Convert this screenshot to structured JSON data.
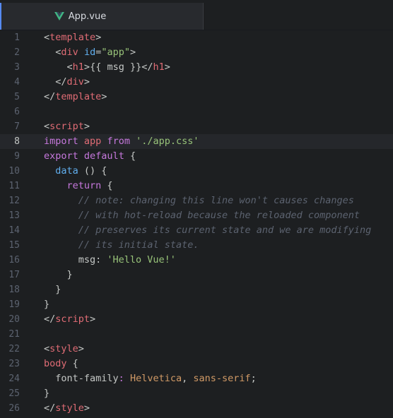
{
  "tab": {
    "filename": "App.vue",
    "icon": "vue-logo-icon",
    "accent_color": "#568af2",
    "vue_green": "#41b883",
    "vue_dark": "#35495e"
  },
  "active_line": 8,
  "lines": [
    {
      "n": "1",
      "tokens": [
        [
          "tag",
          "<"
        ],
        [
          "tagname",
          "template"
        ],
        [
          "tag",
          ">"
        ]
      ]
    },
    {
      "n": "2",
      "tokens": [
        [
          "plain",
          "  "
        ],
        [
          "tag",
          "<"
        ],
        [
          "tagname",
          "div"
        ],
        [
          "plain",
          " "
        ],
        [
          "attr",
          "id"
        ],
        [
          "tag",
          "="
        ],
        [
          "str",
          "\"app\""
        ],
        [
          "tag",
          ">"
        ]
      ]
    },
    {
      "n": "3",
      "tokens": [
        [
          "plain",
          "    "
        ],
        [
          "tag",
          "<"
        ],
        [
          "tagname",
          "h1"
        ],
        [
          "tag",
          ">"
        ],
        [
          "plain",
          "{{ msg }}"
        ],
        [
          "tag",
          "</"
        ],
        [
          "tagname",
          "h1"
        ],
        [
          "tag",
          ">"
        ]
      ]
    },
    {
      "n": "4",
      "tokens": [
        [
          "plain",
          "  "
        ],
        [
          "tag",
          "</"
        ],
        [
          "tagname",
          "div"
        ],
        [
          "tag",
          ">"
        ]
      ]
    },
    {
      "n": "5",
      "tokens": [
        [
          "tag",
          "</"
        ],
        [
          "tagname",
          "template"
        ],
        [
          "tag",
          ">"
        ]
      ]
    },
    {
      "n": "6",
      "tokens": []
    },
    {
      "n": "7",
      "tokens": [
        [
          "tag",
          "<"
        ],
        [
          "tagname",
          "script"
        ],
        [
          "tag",
          ">"
        ]
      ]
    },
    {
      "n": "8",
      "tokens": [
        [
          "kw",
          "import"
        ],
        [
          "plain",
          " "
        ],
        [
          "tagname",
          "app"
        ],
        [
          "plain",
          " "
        ],
        [
          "kw",
          "from"
        ],
        [
          "plain",
          " "
        ],
        [
          "str",
          "'./app.css'"
        ]
      ]
    },
    {
      "n": "9",
      "tokens": [
        [
          "kw",
          "export"
        ],
        [
          "plain",
          " "
        ],
        [
          "kw",
          "default"
        ],
        [
          "plain",
          " {"
        ]
      ]
    },
    {
      "n": "10",
      "tokens": [
        [
          "plain",
          "  "
        ],
        [
          "fn",
          "data"
        ],
        [
          "plain",
          " () {"
        ]
      ]
    },
    {
      "n": "11",
      "tokens": [
        [
          "plain",
          "    "
        ],
        [
          "kw",
          "return"
        ],
        [
          "plain",
          " {"
        ]
      ]
    },
    {
      "n": "12",
      "tokens": [
        [
          "plain",
          "      "
        ],
        [
          "com",
          "// note: changing this line won't causes changes"
        ]
      ]
    },
    {
      "n": "13",
      "tokens": [
        [
          "plain",
          "      "
        ],
        [
          "com",
          "// with hot-reload because the reloaded component"
        ]
      ]
    },
    {
      "n": "14",
      "tokens": [
        [
          "plain",
          "      "
        ],
        [
          "com",
          "// preserves its current state and we are modifying"
        ]
      ]
    },
    {
      "n": "15",
      "tokens": [
        [
          "plain",
          "      "
        ],
        [
          "com",
          "// its initial state."
        ]
      ]
    },
    {
      "n": "16",
      "tokens": [
        [
          "plain",
          "      msg: "
        ],
        [
          "str",
          "'Hello Vue!'"
        ]
      ]
    },
    {
      "n": "17",
      "tokens": [
        [
          "plain",
          "    }"
        ]
      ]
    },
    {
      "n": "18",
      "tokens": [
        [
          "plain",
          "  }"
        ]
      ]
    },
    {
      "n": "19",
      "tokens": [
        [
          "plain",
          "}"
        ]
      ]
    },
    {
      "n": "20",
      "tokens": [
        [
          "tag",
          "</"
        ],
        [
          "tagname",
          "script"
        ],
        [
          "tag",
          ">"
        ]
      ]
    },
    {
      "n": "21",
      "tokens": []
    },
    {
      "n": "22",
      "tokens": [
        [
          "tag",
          "<"
        ],
        [
          "tagname",
          "style"
        ],
        [
          "tag",
          ">"
        ]
      ]
    },
    {
      "n": "23",
      "tokens": [
        [
          "tagname",
          "body"
        ],
        [
          "plain",
          " {"
        ]
      ]
    },
    {
      "n": "24",
      "tokens": [
        [
          "plain",
          "  font-family"
        ],
        [
          "kw",
          ":"
        ],
        [
          "plain",
          " "
        ],
        [
          "val",
          "Helvetica"
        ],
        [
          "plain",
          ", "
        ],
        [
          "val",
          "sans-serif"
        ],
        [
          "plain",
          ";"
        ]
      ]
    },
    {
      "n": "25",
      "tokens": [
        [
          "plain",
          "}"
        ]
      ]
    },
    {
      "n": "26",
      "tokens": [
        [
          "tag",
          "</"
        ],
        [
          "tagname",
          "style"
        ],
        [
          "tag",
          ">"
        ]
      ]
    }
  ]
}
